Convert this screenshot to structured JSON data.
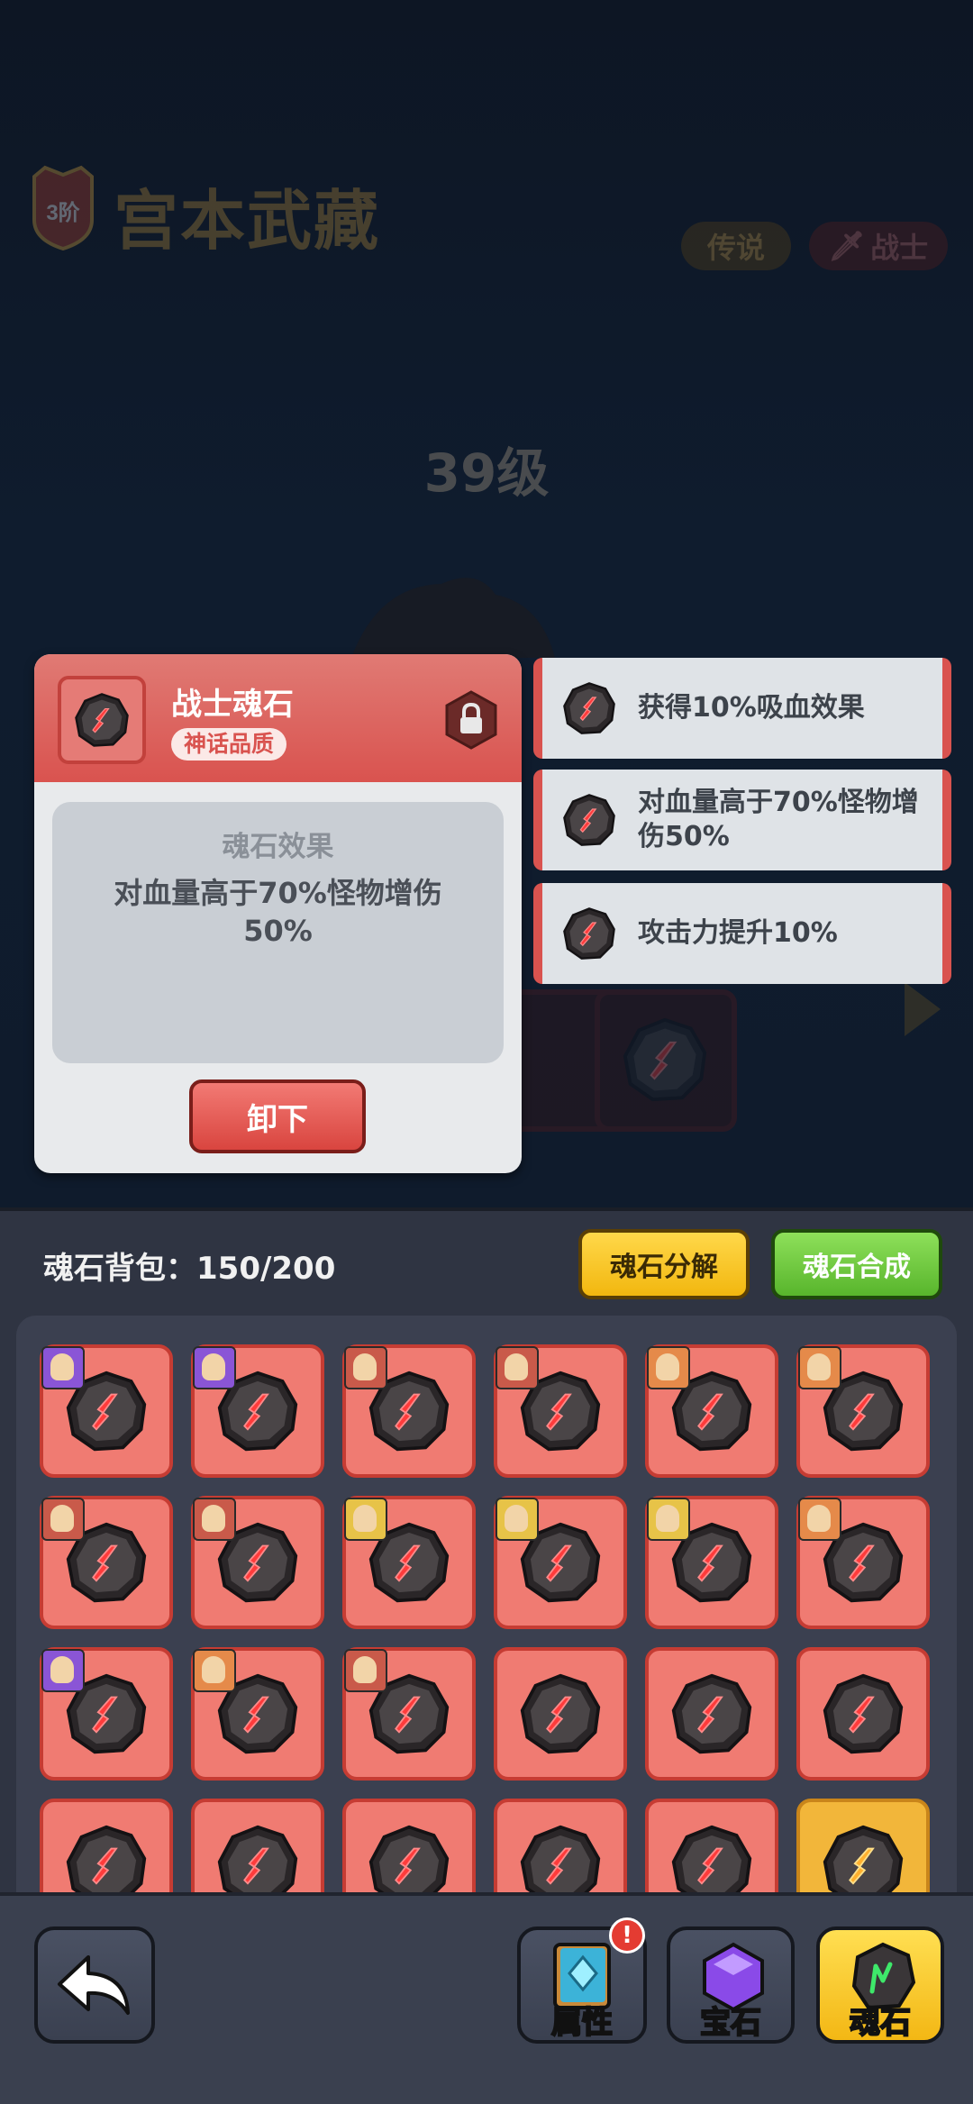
{
  "hero": {
    "rank": "3阶",
    "name": "宫本武藏",
    "rarity": "传说",
    "class": "战士",
    "level": "39级"
  },
  "popup": {
    "title": "战士魂石",
    "quality": "神话品质",
    "effect_title": "魂石效果",
    "effect_desc": "对血量高于70%怪物增伤50%",
    "unequip_label": "卸下"
  },
  "effects": [
    "获得10%吸血效果",
    "对血量高于70%怪物增伤50%",
    "攻击力提升10%"
  ],
  "bag": {
    "title": "魂石背包：150/200",
    "decompose_label": "魂石分解",
    "compose_label": "魂石合成"
  },
  "nav": {
    "attributes_label": "属性",
    "gems_label": "宝石",
    "soulstone_label": "魂石",
    "alert": "!"
  },
  "colors": {
    "accent_red": "#d9534f",
    "accent_gold": "#f3b714",
    "accent_green": "#58b52c"
  }
}
